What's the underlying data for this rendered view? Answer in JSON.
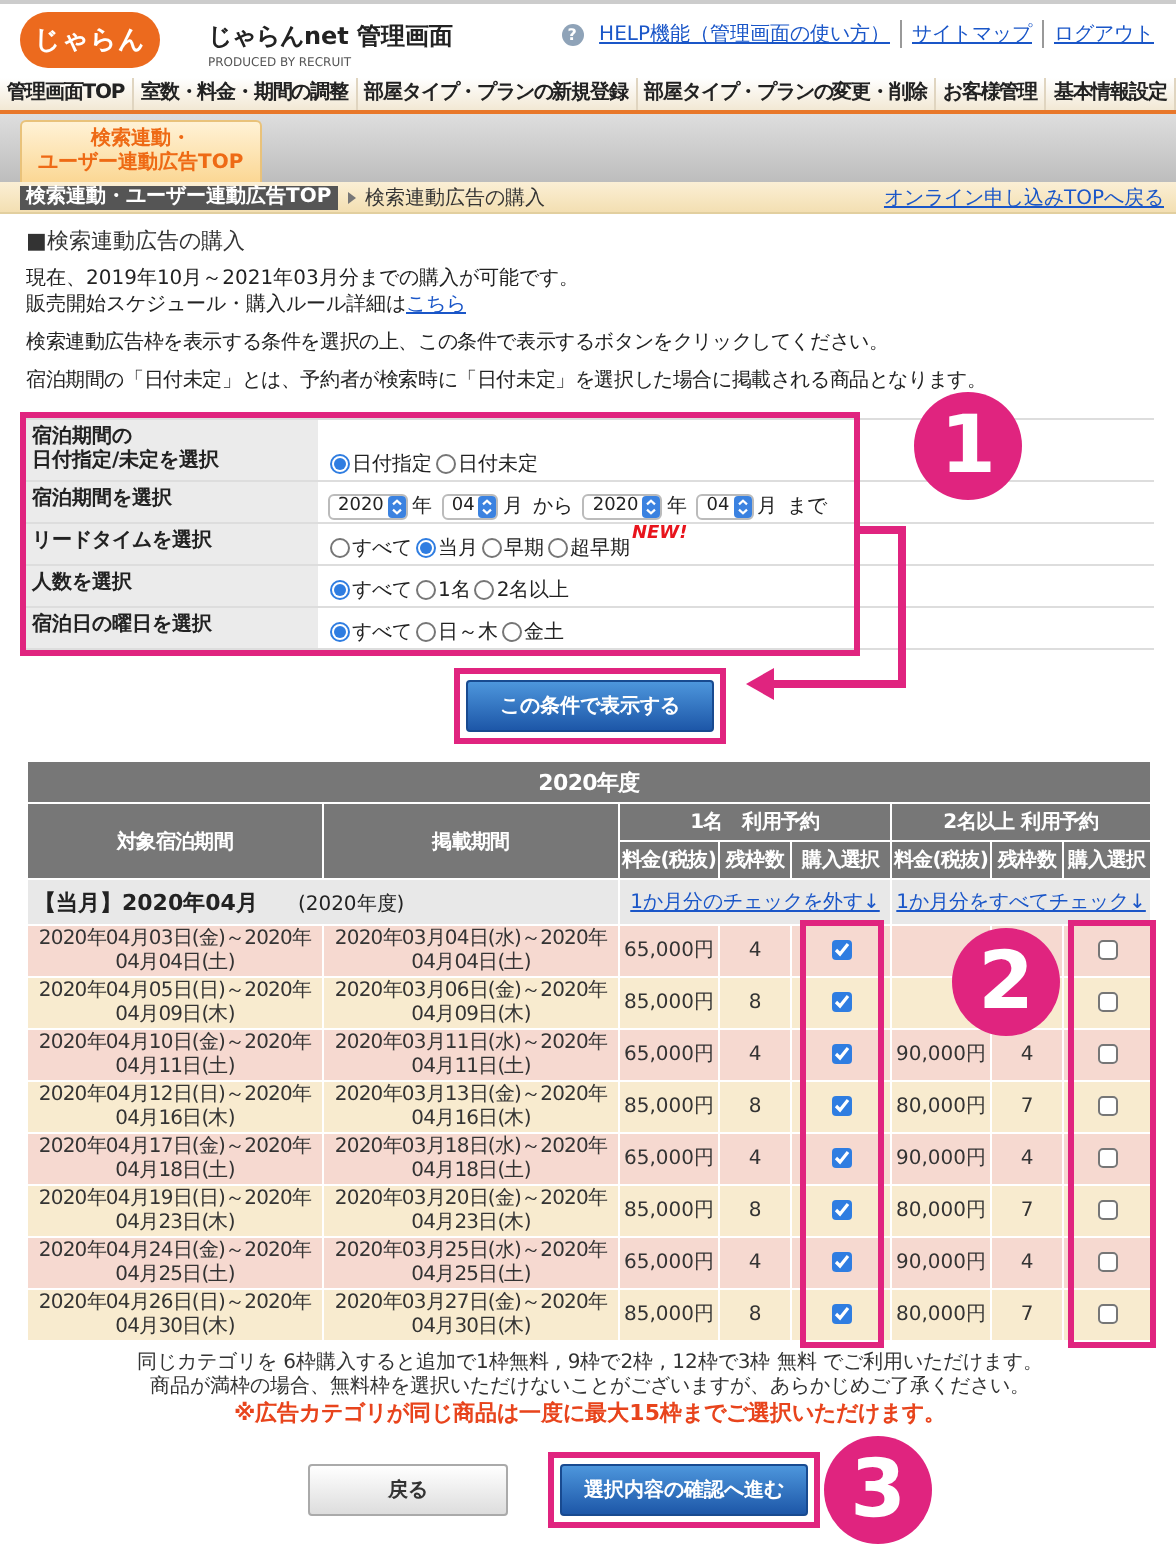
{
  "header": {
    "logo": "じゃらん",
    "title": "じゃらんnet 管理画面",
    "producer": "PRODUCED BY RECRUIT",
    "help_icon": "?",
    "links": [
      "HELP機能（管理画面の使い方）",
      "サイトマップ",
      "ログアウト"
    ]
  },
  "nav": [
    "管理画面TOP",
    "室数・料金・期間の調整",
    "部屋タイプ・プランの新規登録",
    "部屋タイプ・プランの変更・削除",
    "お客様管理",
    "基本情報設定"
  ],
  "tab": {
    "lines": [
      "検索連動・",
      "ユーザー連動広告TOP"
    ]
  },
  "breadcrumb": {
    "items": [
      "検索連動・ユーザー連動広告TOP",
      "検索連動広告の購入"
    ],
    "back_link": "オンライン申し込みTOPへ戻る"
  },
  "heading": "■検索連動広告の購入",
  "availability": "現在、2019年10月～2021年03月分までの購入が可能です。",
  "rules": {
    "text": "販売開始スケジュール・購入ルール詳細は",
    "link": "こちら"
  },
  "instructions": [
    "検索連動広告枠を表示する条件を選択の上、この条件で表示するボタンをクリックしてください。",
    "宿泊期間の「日付未定」とは、予約者が検索時に「日付未定」を選択した場合に掲載される商品となります。"
  ],
  "filters": [
    {
      "kind": "radio",
      "label_lines": [
        "宿泊期間の",
        "日付指定/未定を選択"
      ],
      "options": [
        {
          "label": "日付指定",
          "selected": true
        },
        {
          "label": "日付未定",
          "selected": false
        }
      ]
    },
    {
      "kind": "period",
      "label": "宿泊期間を選択",
      "parts": [
        {
          "kind": "select",
          "value": "2020"
        },
        {
          "kind": "text",
          "text": "年"
        },
        {
          "kind": "select",
          "value": "04"
        },
        {
          "kind": "text",
          "text": "月"
        },
        {
          "kind": "text",
          "text": "から"
        },
        {
          "kind": "select",
          "value": "2020"
        },
        {
          "kind": "text",
          "text": "年"
        },
        {
          "kind": "select",
          "value": "04"
        },
        {
          "kind": "text",
          "text": "月"
        },
        {
          "kind": "text",
          "text": "まで"
        }
      ]
    },
    {
      "kind": "radio",
      "label": "リードタイムを選択",
      "options": [
        {
          "label": "すべて",
          "selected": false
        },
        {
          "label": "当月",
          "selected": true
        },
        {
          "label": "早期",
          "selected": false
        },
        {
          "label": "超早期",
          "selected": false,
          "badge": "NEW!"
        }
      ]
    },
    {
      "kind": "radio",
      "label": "人数を選択",
      "options": [
        {
          "label": "すべて",
          "selected": true
        },
        {
          "label": "1名",
          "selected": false
        },
        {
          "label": "2名以上",
          "selected": false
        }
      ]
    },
    {
      "kind": "radio",
      "label": "宿泊日の曜日を選択",
      "options": [
        {
          "label": "すべて",
          "selected": true
        },
        {
          "label": "日～木",
          "selected": false
        },
        {
          "label": "金土",
          "selected": false
        }
      ]
    }
  ],
  "show_button": "この条件で表示する",
  "table": {
    "title": "2020年度",
    "columns": [
      "対象宿泊期間",
      "掲載期間"
    ],
    "groups": [
      {
        "title": "1名　利用予約",
        "columns": [
          "料金(税抜)",
          "残枠数",
          "購入選択"
        ]
      },
      {
        "title": "2名以上 利用予約",
        "columns": [
          "料金(税抜)",
          "残枠数",
          "購入選択"
        ]
      }
    ],
    "month": {
      "label": "【当月】2020年04月",
      "fiscal": "(2020年度)",
      "actions": [
        "1か月分のチェックを外す↓",
        "1か月分をすべてチェック↓"
      ]
    },
    "rows": [
      {
        "stay": "2020年04月03日(金)～2020年04月04日(土)",
        "listing": "2020年03月04日(水)～2020年04月04日(土)",
        "one": {
          "price": "65,000円",
          "remaining": "4",
          "checked": true
        },
        "two": {
          "checked": false
        }
      },
      {
        "stay": "2020年04月05日(日)～2020年04月09日(木)",
        "listing": "2020年03月06日(金)～2020年04月09日(木)",
        "one": {
          "price": "85,000円",
          "remaining": "8",
          "checked": true
        },
        "two": {
          "checked": false
        }
      },
      {
        "stay": "2020年04月10日(金)～2020年04月11日(土)",
        "listing": "2020年03月11日(水)～2020年04月11日(土)",
        "one": {
          "price": "65,000円",
          "remaining": "4",
          "checked": true
        },
        "two": {
          "price": "90,000円",
          "remaining": "4",
          "checked": false
        }
      },
      {
        "stay": "2020年04月12日(日)～2020年04月16日(木)",
        "listing": "2020年03月13日(金)～2020年04月16日(木)",
        "one": {
          "price": "85,000円",
          "remaining": "8",
          "checked": true
        },
        "two": {
          "price": "80,000円",
          "remaining": "7",
          "checked": false
        }
      },
      {
        "stay": "2020年04月17日(金)～2020年04月18日(土)",
        "listing": "2020年03月18日(水)～2020年04月18日(土)",
        "one": {
          "price": "65,000円",
          "remaining": "4",
          "checked": true
        },
        "two": {
          "price": "90,000円",
          "remaining": "4",
          "checked": false
        }
      },
      {
        "stay": "2020年04月19日(日)～2020年04月23日(木)",
        "listing": "2020年03月20日(金)～2020年04月23日(木)",
        "one": {
          "price": "85,000円",
          "remaining": "8",
          "checked": true
        },
        "two": {
          "price": "80,000円",
          "remaining": "7",
          "checked": false
        }
      },
      {
        "stay": "2020年04月24日(金)～2020年04月25日(土)",
        "listing": "2020年03月25日(水)～2020年04月25日(土)",
        "one": {
          "price": "65,000円",
          "remaining": "4",
          "checked": true
        },
        "two": {
          "price": "90,000円",
          "remaining": "4",
          "checked": false
        }
      },
      {
        "stay": "2020年04月26日(日)～2020年04月30日(木)",
        "listing": "2020年03月27日(金)～2020年04月30日(木)",
        "one": {
          "price": "85,000円",
          "remaining": "8",
          "checked": true
        },
        "two": {
          "price": "80,000円",
          "remaining": "7",
          "checked": false
        }
      }
    ]
  },
  "notes": [
    "同じカテゴリを 6枠購入すると追加で1枠無料 , 9枠で2枠 , 12枠で3枠 無料 でご利用いただけます。",
    "商品が満枠の場合、無料枠を選択いただけないことがございますが、あらかじめご了承ください。"
  ],
  "warning": "※広告カテゴリが同じ商品は一度に最大15枠までご選択いただけます。",
  "buttons": {
    "back": "戻る",
    "confirm": "選択内容の確認へ進む"
  },
  "steps": [
    "1",
    "2",
    "3"
  ]
}
